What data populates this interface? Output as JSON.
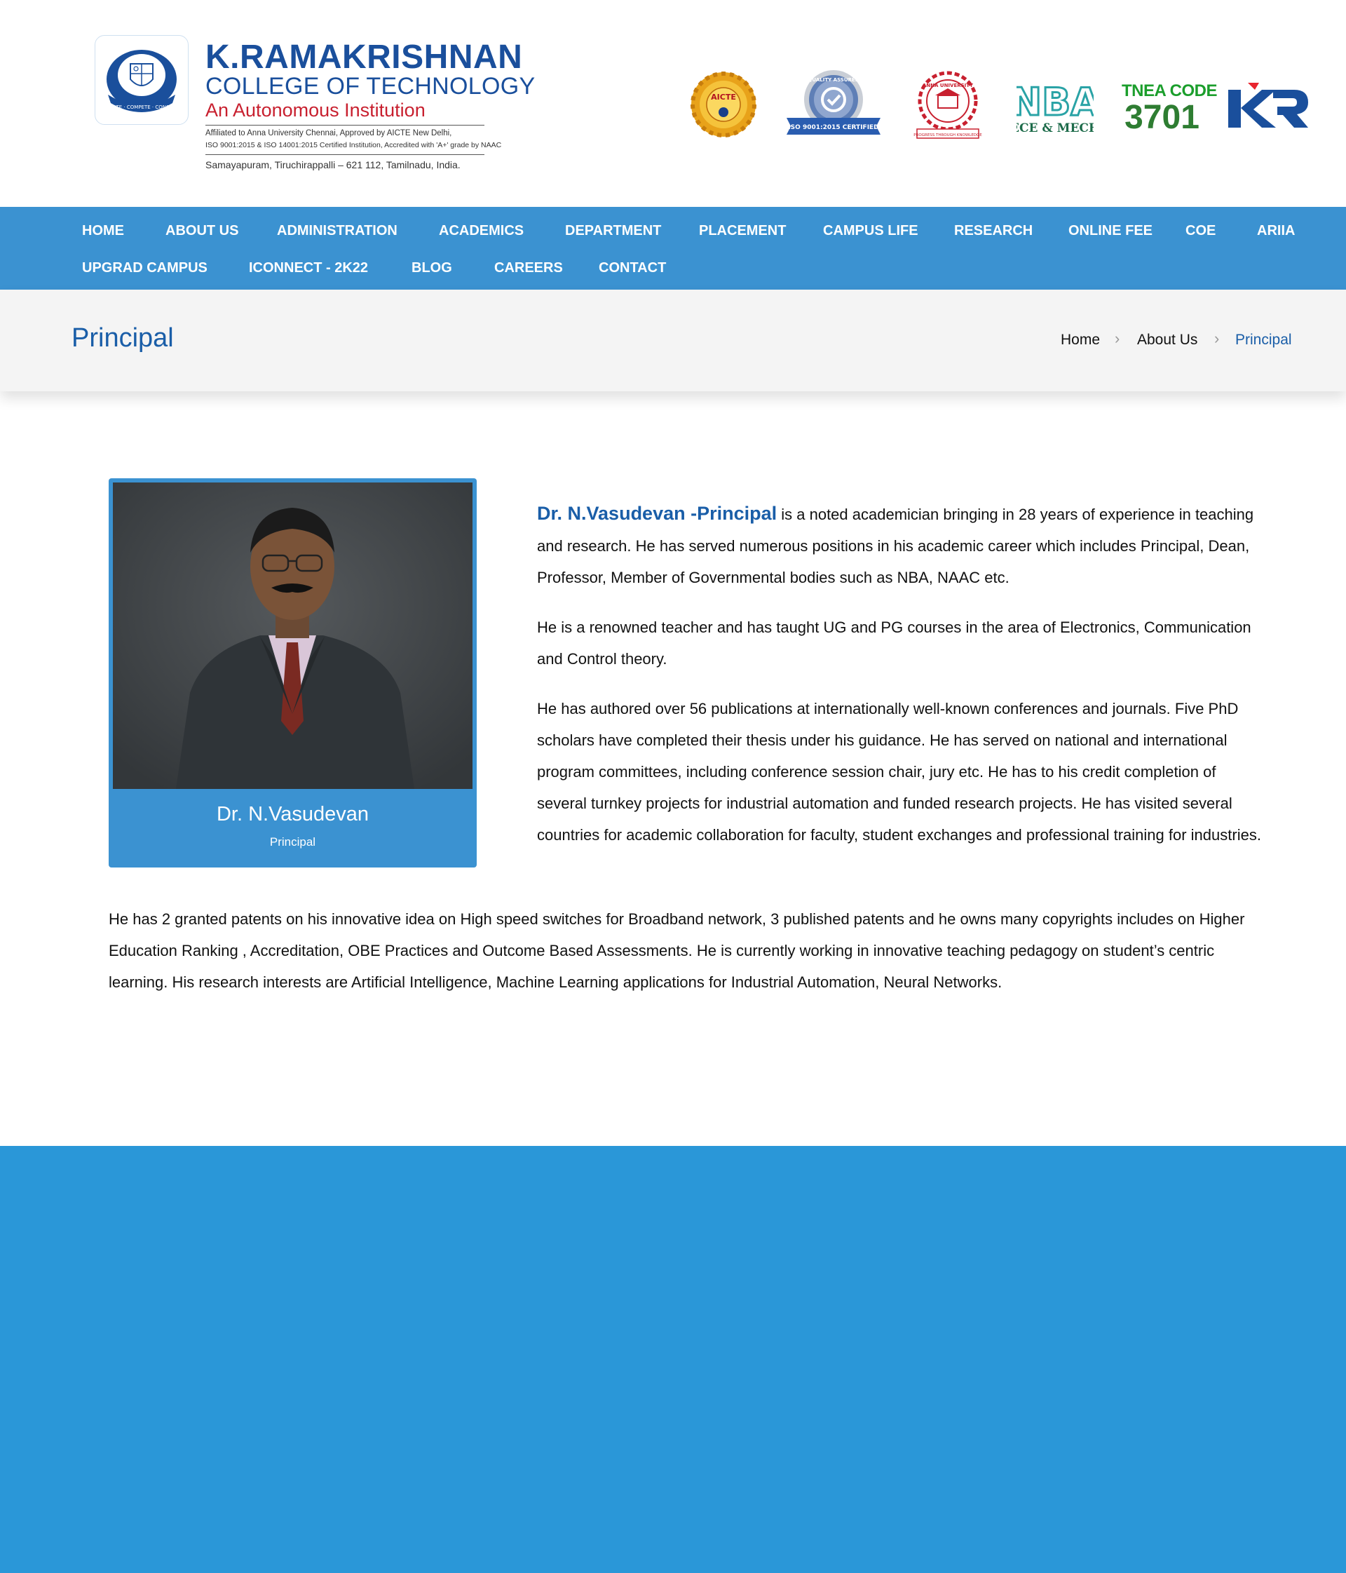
{
  "header": {
    "college_name": "K.RAMAKRISHNAN",
    "college_subtitle": "COLLEGE OF TECHNOLOGY",
    "autonomous": "An Autonomous Institution",
    "affiliation_line1": "Affiliated to Anna University Chennai, Approved by AICTE New Delhi,",
    "affiliation_line2": "ISO 9001:2015 & ISO 14001:2015 Certified Institution, Accredited with 'A+' grade by NAAC",
    "address": "Samayapuram, Tiruchirappalli – 621 112, Tamilnadu, India.",
    "seal_motto": "CREATE · COMPETE · CONQUER",
    "badges": {
      "aicte": "AICTE",
      "iso": "ISO 9001:2015 CERTIFIED",
      "iso_top": "QUALITY ASSURED",
      "anna": "ANNA UNIVERSITY",
      "anna_motto": "PROGRESS THROUGH KNOWLEDGE",
      "nba": "NBA",
      "nba_sub": "ECE & MECH",
      "tnea_label": "TNEA CODE",
      "tnea_code": "3701",
      "kr": "KR"
    }
  },
  "nav": {
    "row1": [
      "HOME",
      "ABOUT US",
      "ADMINISTRATION",
      "ACADEMICS",
      "DEPARTMENT",
      "PLACEMENT",
      "CAMPUS LIFE",
      "RESEARCH",
      "ONLINE FEE",
      "COE",
      "ARIIA"
    ],
    "row2": [
      "UPGRAD CAMPUS",
      "ICONNECT - 2K22",
      "BLOG",
      "CAREERS",
      "CONTACT"
    ]
  },
  "page": {
    "title": "Principal",
    "breadcrumb": [
      "Home",
      "About Us",
      "Principal"
    ]
  },
  "profile": {
    "name": "Dr. N.Vasudevan",
    "role": "Principal"
  },
  "bio": {
    "lead": "Dr. N.Vasudevan  -Principal",
    "p1": " is a noted academician bringing in 28 years of experience in teaching and research. He has served numerous positions in his academic career which includes Principal, Dean, Professor, Member of Governmental bodies such as NBA, NAAC etc.",
    "p2": "He is a renowned teacher and has taught UG and PG courses in the area of Electronics, Communication and Control theory.",
    "p3": "He has authored over 56 publications at internationally well-known conferences and journals. Five PhD scholars have completed their thesis under his guidance. He has served on national and international program committees, including conference session chair, jury etc. He has to his credit completion of several turnkey projects for industrial automation and funded research projects. He has visited several countries for academic collaboration for faculty, student exchanges and professional training for industries.",
    "p4": "He has 2 granted patents on his innovative idea on High speed switches for Broadband network, 3 published patents and he owns many copyrights includes on Higher Education Ranking , Accreditation, OBE Practices and Outcome Based Assessments. He is currently working in innovative teaching pedagogy on student’s centric learning. His research interests are Artificial Intelligence, Machine Learning applications for Industrial Automation, Neural Networks."
  },
  "colors": {
    "nav_bg": "#3b92d1",
    "brand_blue": "#1a5ea8",
    "footer_bg": "#2a97d8",
    "title_bar_bg": "#f4f4f4"
  }
}
